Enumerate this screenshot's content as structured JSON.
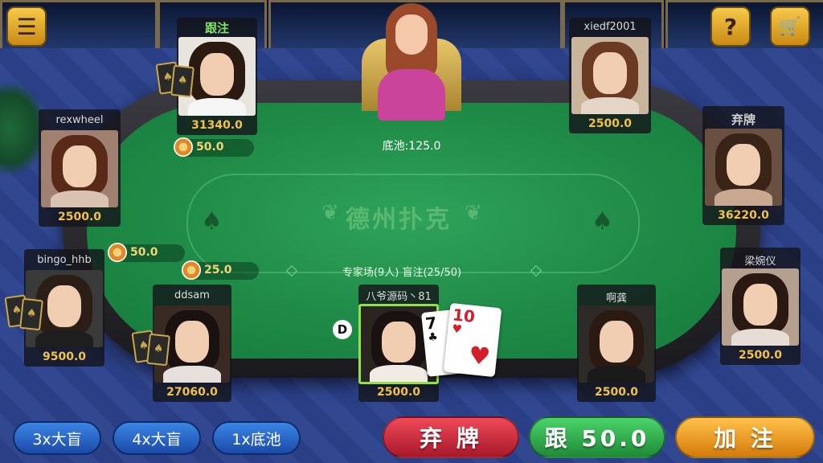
{
  "icons": {
    "menu": "menu-icon",
    "help": "question-icon",
    "shop": "cart-icon"
  },
  "colors": {
    "felt": "#1f8a47",
    "stack_gold": "#f1c24a",
    "fold_red": "#c9283a",
    "call_green": "#2aa84a",
    "raise_orange": "#e59a12"
  },
  "pot": "底池:125.0",
  "table_logo": "德州扑克",
  "table_info": "专家场(9人) 盲注(25/50)",
  "dealer_button": "D",
  "players": [
    {
      "id": "p1",
      "name": "",
      "stack": "31340.0",
      "status": "跟注",
      "bet": "50.0"
    },
    {
      "id": "p2",
      "name": "xiedf2001",
      "stack": "2500.0"
    },
    {
      "id": "p3",
      "name": "rexwheel",
      "stack": "2500.0"
    },
    {
      "id": "p4",
      "name": "",
      "stack": "36220.0",
      "status": "弃牌"
    },
    {
      "id": "p5",
      "name": "bingo_hhb",
      "stack": "9500.0",
      "bet": "50.0"
    },
    {
      "id": "p6",
      "name": "ddsam",
      "stack": "27060.0",
      "bet": "25.0"
    },
    {
      "id": "p7",
      "name": "八爷源码丶81",
      "stack": "2500.0"
    },
    {
      "id": "p8",
      "name": "啊龚",
      "stack": "2500.0"
    },
    {
      "id": "p9",
      "name": "梁婉仪",
      "stack": "2500.0"
    }
  ],
  "hole_cards": [
    {
      "rank": "7",
      "suit": "♣"
    },
    {
      "rank": "10",
      "suit": "♥"
    }
  ],
  "quick_bets": [
    "3x大盲",
    "4x大盲",
    "1x底池"
  ],
  "actions": {
    "fold": "弃 牌",
    "call": "跟 50.0",
    "raise": "加 注"
  }
}
